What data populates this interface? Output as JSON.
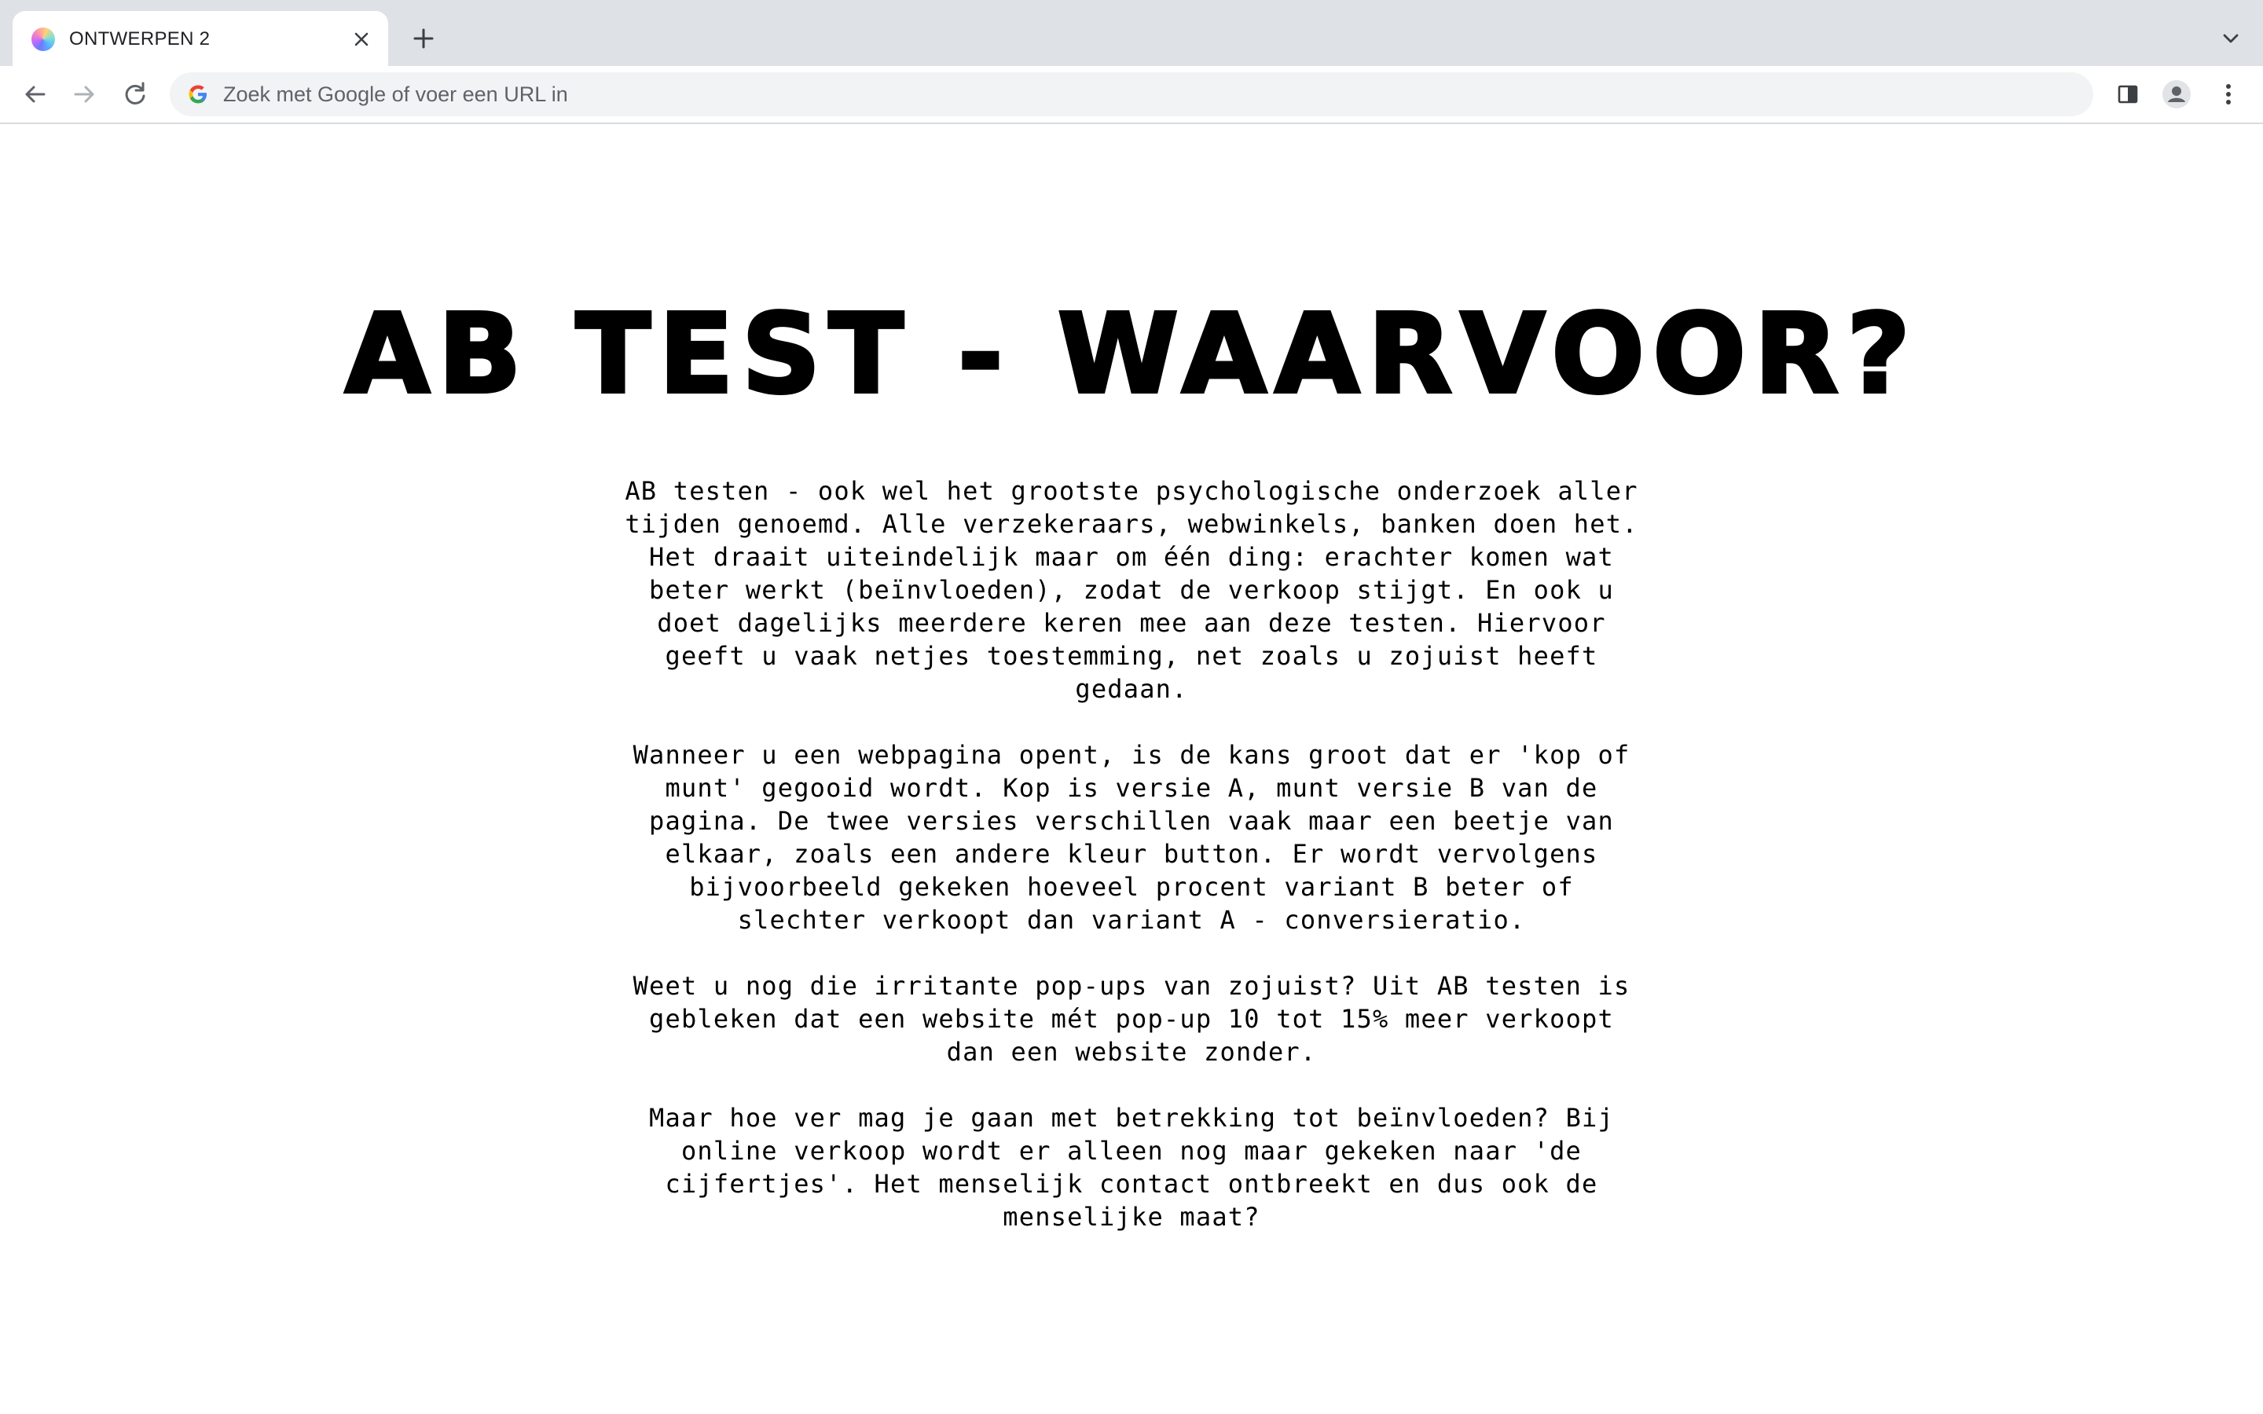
{
  "browser": {
    "tab": {
      "title": "ONTWERPEN 2",
      "favicon": "gradient-orb-icon"
    },
    "omnibox": {
      "placeholder": "Zoek met Google of voer een URL in",
      "value": ""
    }
  },
  "page": {
    "headline": "AB TEST - WAARVOOR?",
    "paragraphs": [
      "AB testen - ook wel het grootste psychologische onderzoek aller tijden genoemd. Alle verzekeraars, webwinkels, banken doen het. Het draait uiteindelijk maar om één ding: erachter komen wat beter werkt (beïnvloeden), zodat de verkoop stijgt. En ook u doet dagelijks meerdere keren mee aan deze testen. Hiervoor geeft u vaak netjes toestemming, net zoals u zojuist heeft gedaan.",
      "Wanneer u een webpagina opent, is de kans groot dat er 'kop of munt' gegooid wordt. Kop is versie A, munt versie B van de pagina. De twee versies verschillen vaak maar een beetje van elkaar, zoals een andere kleur button. Er wordt vervolgens bijvoorbeeld gekeken hoeveel procent variant B beter of slechter verkoopt dan variant A - conversieratio.",
      "Weet u nog die irritante pop-ups van zojuist? Uit AB testen is gebleken dat een website mét pop-up 10 tot 15% meer verkoopt dan een website zonder.",
      "Maar hoe ver mag je gaan met betrekking tot beïnvloeden? Bij online verkoop wordt er alleen nog maar gekeken naar 'de cijfertjes'. Het menselijk contact ontbreekt en dus ook de menselijke maat?"
    ]
  }
}
